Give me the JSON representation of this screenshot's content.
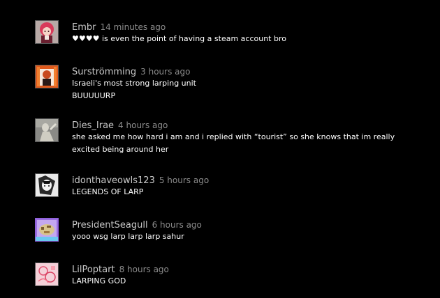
{
  "comments": [
    {
      "author": "Embr",
      "time": "14 minutes ago",
      "text": "♥♥♥♥ is even the point of having a steam account bro",
      "avatar": "anime-girl-red-hair-avatar"
    },
    {
      "author": "Surströmming",
      "time": "3 hours ago",
      "text": "Israeli's most strong larping unit\nBUUUUURP",
      "avatar": "anime-character-orange-avatar"
    },
    {
      "author": "Dies_Irae",
      "time": "4 hours ago",
      "text": "she asked me how hard i am and i replied with “tourist” so she knows that im really\nexcited being around her",
      "avatar": "statue-avatar"
    },
    {
      "author": "idonthaveowls123",
      "time": "5 hours ago",
      "text": "LEGENDS OF LARP",
      "avatar": "manga-panel-avatar"
    },
    {
      "author": "PresidentSeagull",
      "time": "6 hours ago",
      "text": "yooo wsg larp larp larp sahur",
      "avatar": "pixel-art-avatar"
    },
    {
      "author": "LilPoptart",
      "time": "8 hours ago",
      "text": "LARPING GOD",
      "avatar": "pink-sketch-avatar"
    }
  ]
}
